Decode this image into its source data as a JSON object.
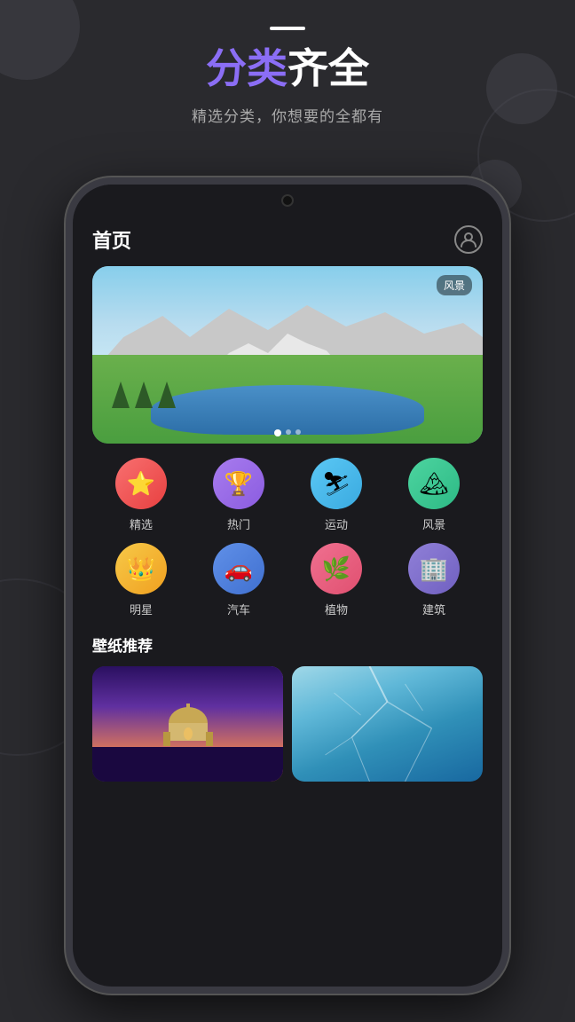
{
  "background": {
    "color": "#2a2a2e"
  },
  "header": {
    "dash": true,
    "title_highlight": "分类",
    "title_rest": "齐全",
    "subtitle": "精选分类，你想要的全都有"
  },
  "phone": {
    "app_title": "首页",
    "profile_icon": "👤",
    "banner": {
      "label": "风景",
      "dots": [
        true,
        false,
        false
      ]
    },
    "categories": [
      {
        "id": "jingxuan",
        "label": "精选",
        "icon": "⭐",
        "color_class": "cat-jingxuan"
      },
      {
        "id": "hot",
        "label": "热门",
        "icon": "🏆",
        "color_class": "cat-hot"
      },
      {
        "id": "sport",
        "label": "运动",
        "icon": "⛷",
        "color_class": "cat-sport"
      },
      {
        "id": "scenery",
        "label": "风景",
        "icon": "🏔",
        "color_class": "cat-scenery"
      },
      {
        "id": "star",
        "label": "明星",
        "icon": "👑",
        "color_class": "cat-star"
      },
      {
        "id": "car",
        "label": "汽车",
        "icon": "🚗",
        "color_class": "cat-car"
      },
      {
        "id": "plant",
        "label": "植物",
        "icon": "🌿",
        "color_class": "cat-plant"
      },
      {
        "id": "building",
        "label": "建筑",
        "icon": "🏢",
        "color_class": "cat-building"
      }
    ],
    "rec_section": {
      "title": "壁纸推荐",
      "cards": [
        {
          "id": "cathedral",
          "type": "city-night"
        },
        {
          "id": "ocean",
          "type": "ice-ocean"
        }
      ]
    }
  }
}
